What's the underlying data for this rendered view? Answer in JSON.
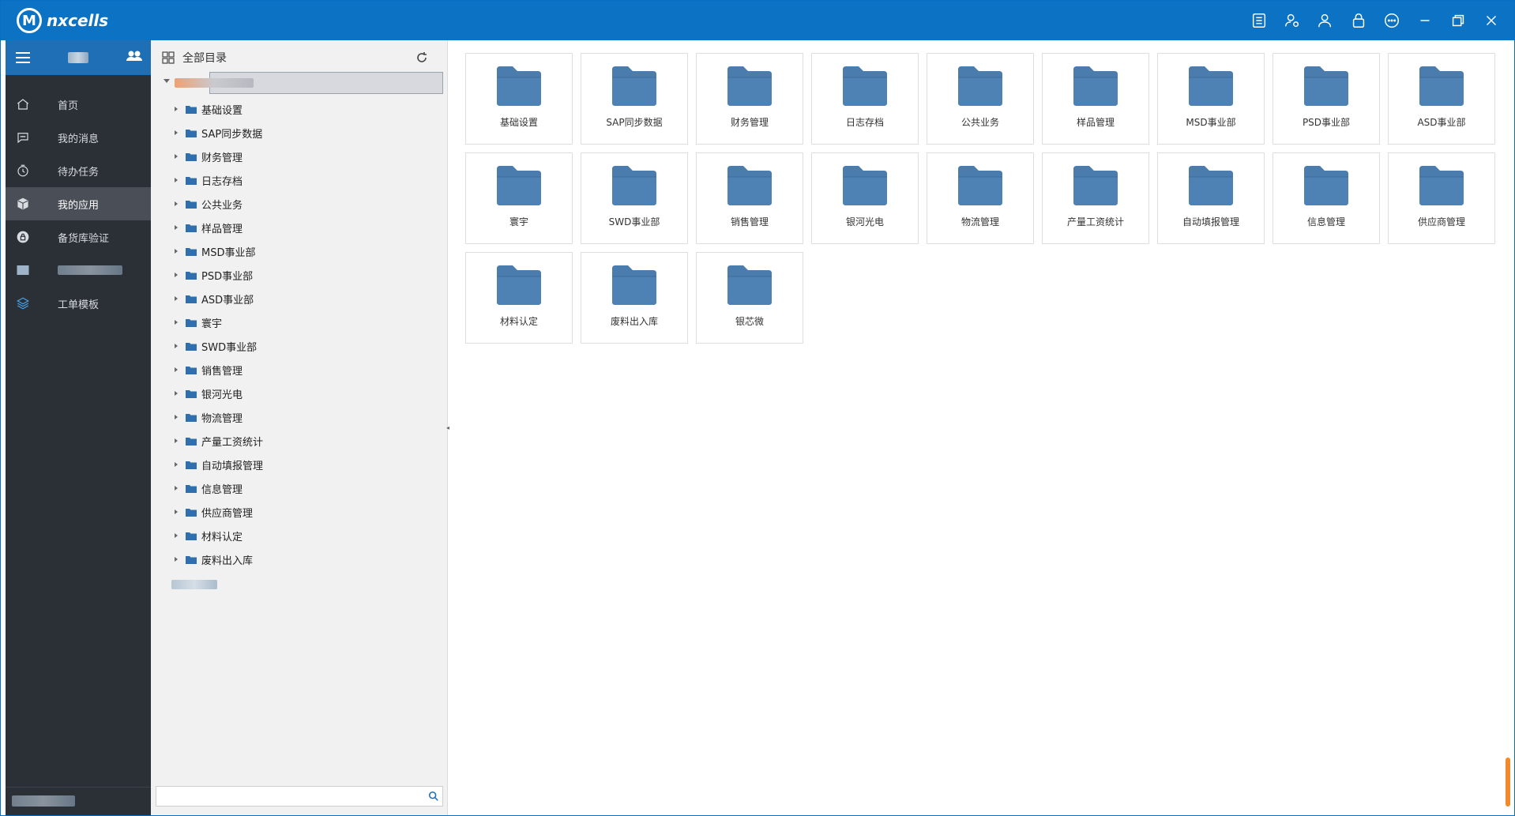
{
  "app": {
    "logo_text": "nxcells"
  },
  "title_actions": [
    {
      "name": "notes-icon"
    },
    {
      "name": "user-settings-icon"
    },
    {
      "name": "user-icon"
    },
    {
      "name": "lock-icon"
    },
    {
      "name": "more-icon"
    },
    {
      "name": "minimize-icon"
    },
    {
      "name": "restore-icon"
    },
    {
      "name": "close-icon"
    }
  ],
  "sidebar": {
    "items": [
      {
        "label": "首页",
        "icon": "home-icon"
      },
      {
        "label": "我的消息",
        "icon": "message-icon"
      },
      {
        "label": "待办任务",
        "icon": "clock-icon"
      },
      {
        "label": "我的应用",
        "icon": "box-icon",
        "active": true
      },
      {
        "label": "备货库验证",
        "icon": "lock-badge-icon"
      },
      {
        "label": "",
        "icon": "blurred-icon"
      },
      {
        "label": "工单模板",
        "icon": "layers-icon"
      }
    ]
  },
  "tree": {
    "header": "全部目录",
    "items": [
      "基础设置",
      "SAP同步数据",
      "财务管理",
      "日志存档",
      "公共业务",
      "样品管理",
      "MSD事业部",
      "PSD事业部",
      "ASD事业部",
      "寰宇",
      "SWD事业部",
      "销售管理",
      "银河光电",
      "物流管理",
      "产量工资统计",
      "自动填报管理",
      "信息管理",
      "供应商管理",
      "材料认定",
      "废料出入库"
    ],
    "search_placeholder": ""
  },
  "folders": [
    "基础设置",
    "SAP同步数据",
    "财务管理",
    "日志存档",
    "公共业务",
    "样品管理",
    "MSD事业部",
    "PSD事业部",
    "ASD事业部",
    "寰宇",
    "SWD事业部",
    "销售管理",
    "银河光电",
    "物流管理",
    "产量工资统计",
    "自动填报管理",
    "信息管理",
    "供应商管理",
    "材料认定",
    "废料出入库",
    "银芯微"
  ],
  "colors": {
    "titlebar": "#0b72c4",
    "sidebar": "#2b2f36",
    "folder": "#4a7cae",
    "accent": "#f08a2c"
  }
}
